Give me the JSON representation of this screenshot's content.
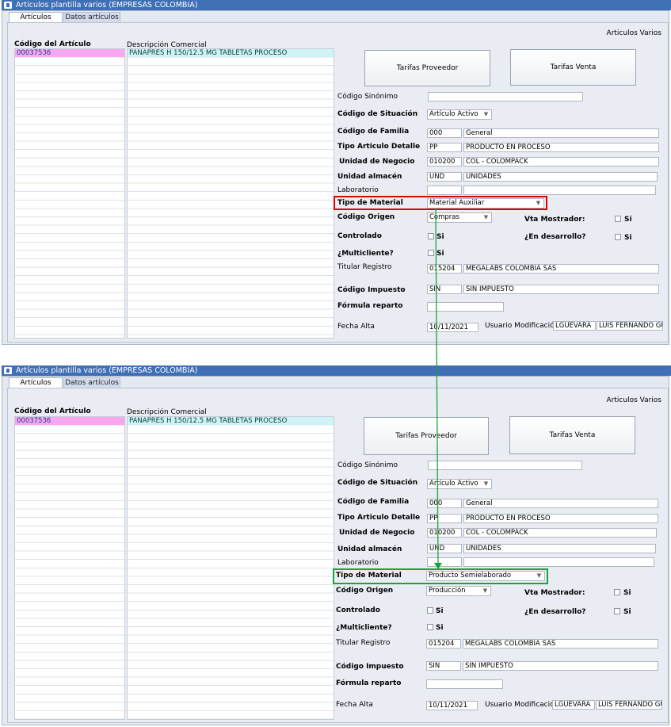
{
  "window": {
    "title": "Artículos plantilla varios (EMPRESAS COLOMBIA)"
  },
  "tabs": [
    "Artículos",
    "Datos artículos"
  ],
  "header_right": "Articulos Varios",
  "grid": {
    "col1_header": "Código del Artículo",
    "col2_header": "Descripción Comercial",
    "selected_code": "00037536",
    "selected_desc": "PANAPRES H 150/12.5 MG TABLETAS PROCESO"
  },
  "buttons": {
    "tarifas_proveedor": "Tarifas Proveedor",
    "tarifas_venta": "Tarifas Venta"
  },
  "labels": {
    "codigo_sinonimo": "Código Sinónimo",
    "codigo_situacion": "Código de Situación",
    "codigo_familia": "Código de Familia",
    "tipo_articulo": "Tipo Articulo Detalle",
    "unidad_negocio": "Unidad de Negocio",
    "unidad_almacen": "Unidad almacén",
    "laboratorio": "Laboratorio",
    "tipo_material": "Tipo de Material",
    "codigo_origen": "Código Origen",
    "vta_mostrador": "Vta Mostrador:",
    "controlado": "Controlado",
    "en_desarrollo": "¿En desarrollo?",
    "multicliente": "¿Multicliente?",
    "titular_registro": "Titular Registro",
    "codigo_impuesto": "Código Impuesto",
    "formula_reparto": "Fórmula reparto",
    "fecha_alta": "Fecha Alta",
    "usuario_modificacion": "Usuario Modificación",
    "si": "Si"
  },
  "before": {
    "situacion": "Artículo Activo",
    "familia_code": "000",
    "familia_name": "General",
    "tipo_articulo_code": "PP",
    "tipo_articulo_name": "PRODUCTO EN PROCESO",
    "unidad_negocio_code": "010200",
    "unidad_negocio_name": "COL - COLOMPACK",
    "unidad_almacen_code": "UND",
    "unidad_almacen_name": "UNIDADES",
    "tipo_material": "Material Auxiliar",
    "codigo_origen": "Compras",
    "titular_code": "015204",
    "titular_name": "MEGALABS COLOMBIA SAS",
    "impuesto_code": "SIN",
    "impuesto_name": "SIN IMPUESTO",
    "fecha_alta": "10/11/2021",
    "usuario_code": "LGUEVARA",
    "usuario_name": "LUIS FERNANDO GU"
  },
  "after": {
    "situacion": "Artículo Activo",
    "familia_code": "000",
    "familia_name": "General",
    "tipo_articulo_code": "PP",
    "tipo_articulo_name": "PRODUCTO EN PROCESO",
    "unidad_negocio_code": "010200",
    "unidad_negocio_name": "COL - COLOMPACK",
    "unidad_almacen_code": "UND",
    "unidad_almacen_name": "UNIDADES",
    "tipo_material": "Producto Semielaborado",
    "codigo_origen": "Producción",
    "titular_code": "015204",
    "titular_name": "MEGALABS COLOMBIA SAS",
    "impuesto_code": "SIN",
    "impuesto_name": "SIN IMPUESTO",
    "fecha_alta": "10/11/2021",
    "usuario_code": "LGUEVARA",
    "usuario_name": "LUIS FERNANDO GU"
  },
  "colors": {
    "titlebar": "#3f6fb4",
    "code_highlight": "#f7a8f0",
    "desc_highlight": "#cff4f7",
    "before_highlight": "#e00000",
    "after_highlight": "#1aa33a",
    "arrow": "#1aa33a"
  }
}
